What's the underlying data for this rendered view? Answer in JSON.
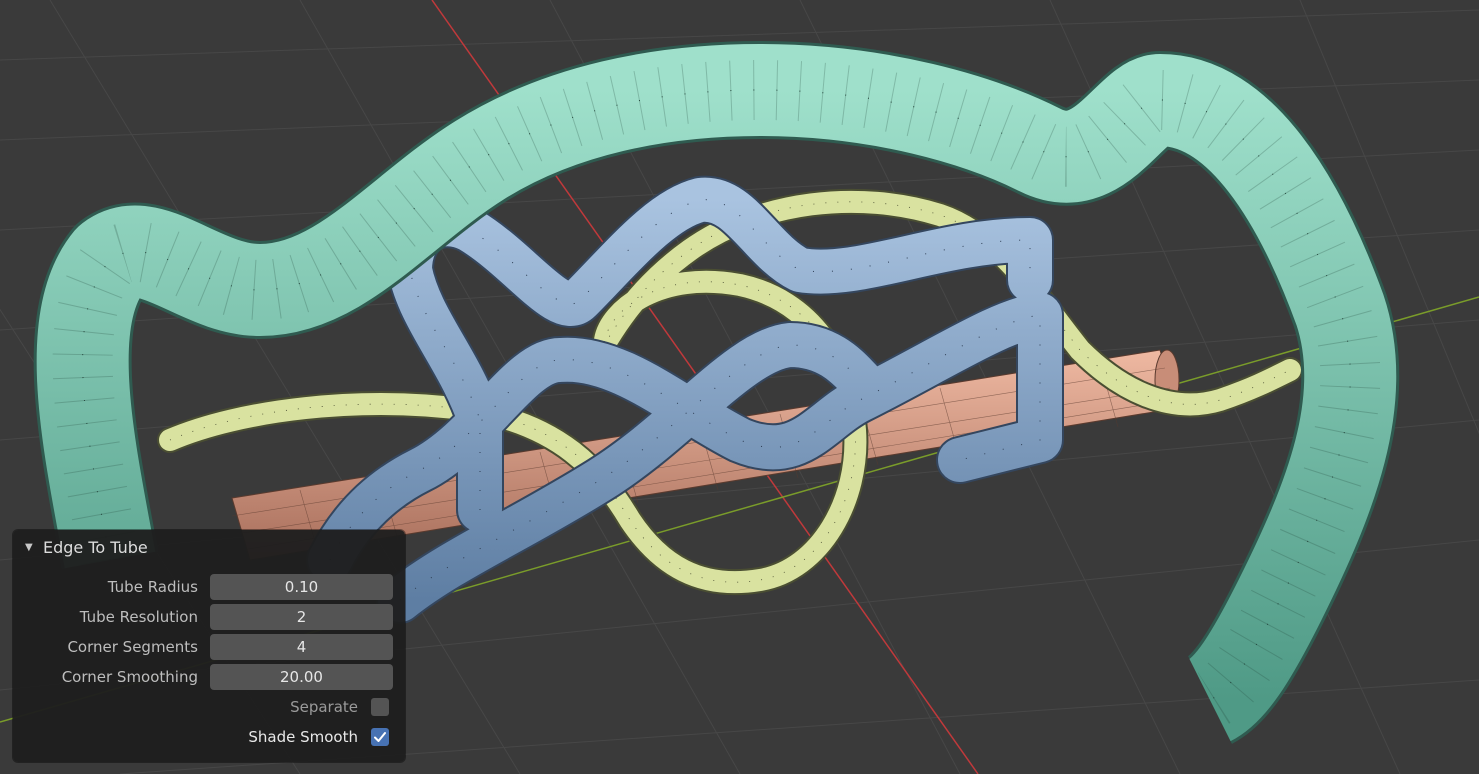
{
  "panel": {
    "title": "Edge To Tube",
    "fields": [
      {
        "label": "Tube Radius",
        "value": "0.10"
      },
      {
        "label": "Tube Resolution",
        "value": "2"
      },
      {
        "label": "Corner Segments",
        "value": "4"
      },
      {
        "label": "Corner Smoothing",
        "value": "20.00"
      }
    ],
    "checkboxes": [
      {
        "label": "Separate",
        "checked": false
      },
      {
        "label": "Shade Smooth",
        "checked": true
      }
    ]
  },
  "colors": {
    "background": "#3a3a3a",
    "x_axis": "#c0393b",
    "y_axis": "#7a9c2a",
    "green_tube": "#7fc9b3",
    "blue_tube": "#8aa6c6",
    "yellow_tube": "#d9e2a0",
    "copper_tube": "#d9a08a",
    "checkbox_on": "#4772b3"
  }
}
